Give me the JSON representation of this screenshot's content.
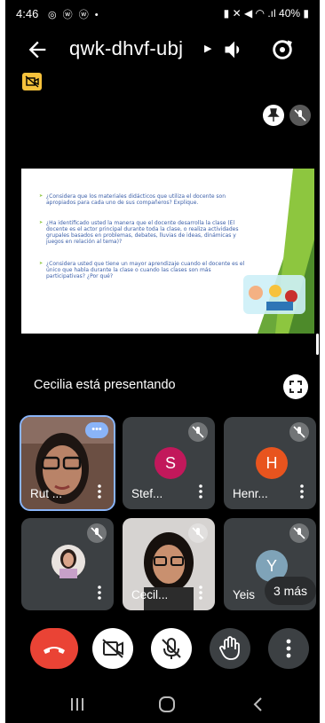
{
  "status_bar": {
    "time": "4:46",
    "battery": "40%"
  },
  "header": {
    "meeting_code": "qwk-dhvf-ubj"
  },
  "presentation": {
    "presenter_text": "Cecilia está presentando",
    "slide_questions": [
      "¿Considera que los materiales didácticos que utiliza el docente son apropiados para cada uno de sus compañeros? Explique.",
      "¿Ha identificado usted la manera que el docente desarrolla la clase (El docente es el actor principal durante toda la clase, o realiza actividades grupales basados en problemas, debates, lluvias de ideas, dinámicas y juegos en relación al tema)?",
      "¿Considera usted que tiene un mayor aprendizaje cuando el docente es el único que habla durante la clase o cuando las clases son más participativas? ¿Por qué?"
    ]
  },
  "participants": [
    {
      "name": "Rut ...",
      "type": "video"
    },
    {
      "name": "Stef...",
      "initial": "S",
      "color": "#c2185b"
    },
    {
      "name": "Henr...",
      "initial": "H",
      "color": "#e8541e"
    },
    {
      "name": "",
      "type": "photo"
    },
    {
      "name": "Cecil...",
      "type": "video"
    },
    {
      "name": "Yeis",
      "initial": "Y",
      "color": "#7fa3b8"
    }
  ],
  "more_participants": "3 más",
  "colors": {
    "end_call": "#ea4335",
    "tile_bg": "#3c4043",
    "active_outline": "#8ab4f8",
    "badge": "#f7c23c"
  }
}
